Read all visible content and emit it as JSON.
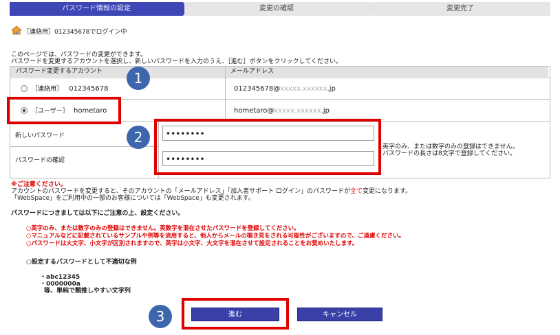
{
  "steps": [
    "パスワード情報の設定",
    "変更の確認",
    "変更完了"
  ],
  "login": {
    "text": "［連絡用］012345678でログイン中"
  },
  "intro": {
    "line1": "このページでは、パスワードの変更ができます。",
    "line2": "パスワードを変更するアカウントを選択し、新しいパスワードを入力のうえ、［進む］ボタンをクリックしてください。"
  },
  "table": {
    "header_account": "パスワード変更するアカウント",
    "header_email": "メールアドレス",
    "accounts": [
      {
        "label": "［連絡用］",
        "id": "012345678",
        "email_prefix": "012345678@",
        "email_masked": "xxxxx.xxxxxx",
        "email_suffix": ".jp",
        "selected": false
      },
      {
        "label": "［ユーザー］",
        "id": "hometaro",
        "email_prefix": "hometaro@",
        "email_masked": "xxxxx.xxxxxx",
        "email_suffix": ".jp",
        "selected": true
      }
    ],
    "new_password_label": "新しいパスワード",
    "confirm_password_label": "パスワードの確認",
    "new_password_value": "••••••••",
    "confirm_password_value": "••••••••",
    "password_note_line1": "英字のみ、または数字のみの登録はできません。",
    "password_note_line2": "パスワードの長さは8文字で登録してください。"
  },
  "caution": {
    "title": "※ご注意ください。",
    "line1_a": "アカウントのパスワードを変更すると、そのアカウントの「メールアドレス」「加入者サポート ログイン」のパスワードが",
    "line1_red": "全て",
    "line1_b": "変更になります。",
    "line2": "「WebSpace」をご利用中の一部のお客様については「WebSpace」も変更されます。"
  },
  "notice_heading": "パスワードにつきましては以下にご注意の上、設定ください。",
  "rules": [
    "○英字のみ、または数字のみの登録はできません。英数字を混在させたパスワードを登録してください。",
    "○マニュアルなどに記載されているサンプルや例等を流用すると、他人からメールの覗き見をされる可能性がございますので、ご遠慮ください。",
    "○パスワードは大文字、小文字が区別されますので、英字は小文字、大文字を混在させて設定されることをお奨めいたします。"
  ],
  "bad_examples": {
    "heading": "○設定するパスワードとして不適切な例",
    "items": [
      "・abc12345",
      "・0000000a",
      "等、単純で類推しやすい文字列"
    ]
  },
  "buttons": {
    "next": "進む",
    "cancel": "キャンセル"
  },
  "markers": [
    "1",
    "2",
    "3"
  ],
  "colors": {
    "step_active": "#3d46b4",
    "highlight": "#e00000",
    "marker": "#3e66ad",
    "button": "#3a40a8"
  }
}
